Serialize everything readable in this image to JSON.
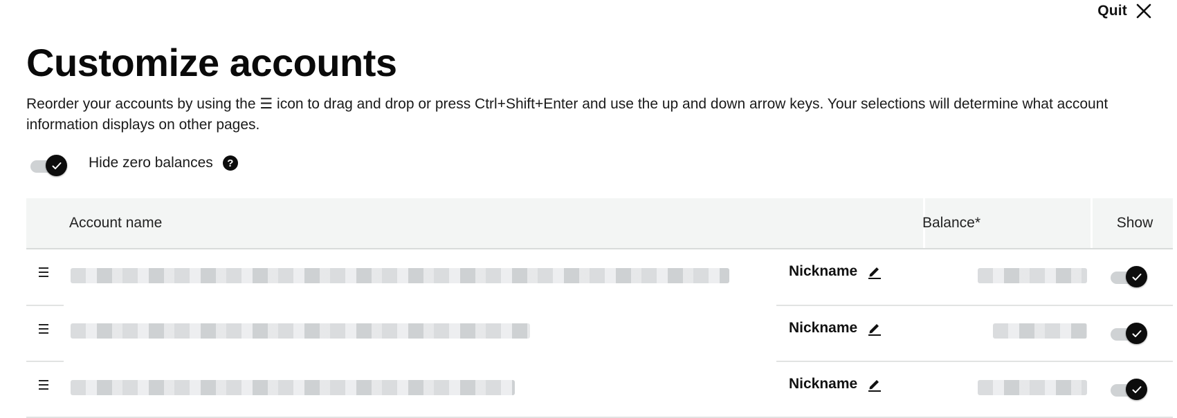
{
  "header": {
    "quit_label": "Quit",
    "title": "Customize accounts",
    "intro_before": "Reorder your accounts by using the ",
    "intro_icon": "☰",
    "intro_after": " icon to drag and drop or press Ctrl+Shift+Enter and use the up and down arrow keys. Your selections will determine what account information displays on other pages."
  },
  "hide_zero": {
    "label": "Hide zero balances",
    "checked": true,
    "help_glyph": "?"
  },
  "table": {
    "columns": {
      "name": "Account name",
      "balance": "Balance*",
      "show": "Show"
    },
    "rows": [
      {
        "nickname_label": "Nickname",
        "show": true
      },
      {
        "nickname_label": "Nickname",
        "show": true
      },
      {
        "nickname_label": "Nickname",
        "show": true
      }
    ]
  },
  "icons": [
    "close-icon",
    "check-icon",
    "help-icon",
    "drag-handle-icon",
    "pencil-icon"
  ],
  "colors": {
    "toggle_on": "#0d0d0d",
    "toggle_track": "#cfd2d4",
    "header_bg": "#f3f5f4"
  }
}
